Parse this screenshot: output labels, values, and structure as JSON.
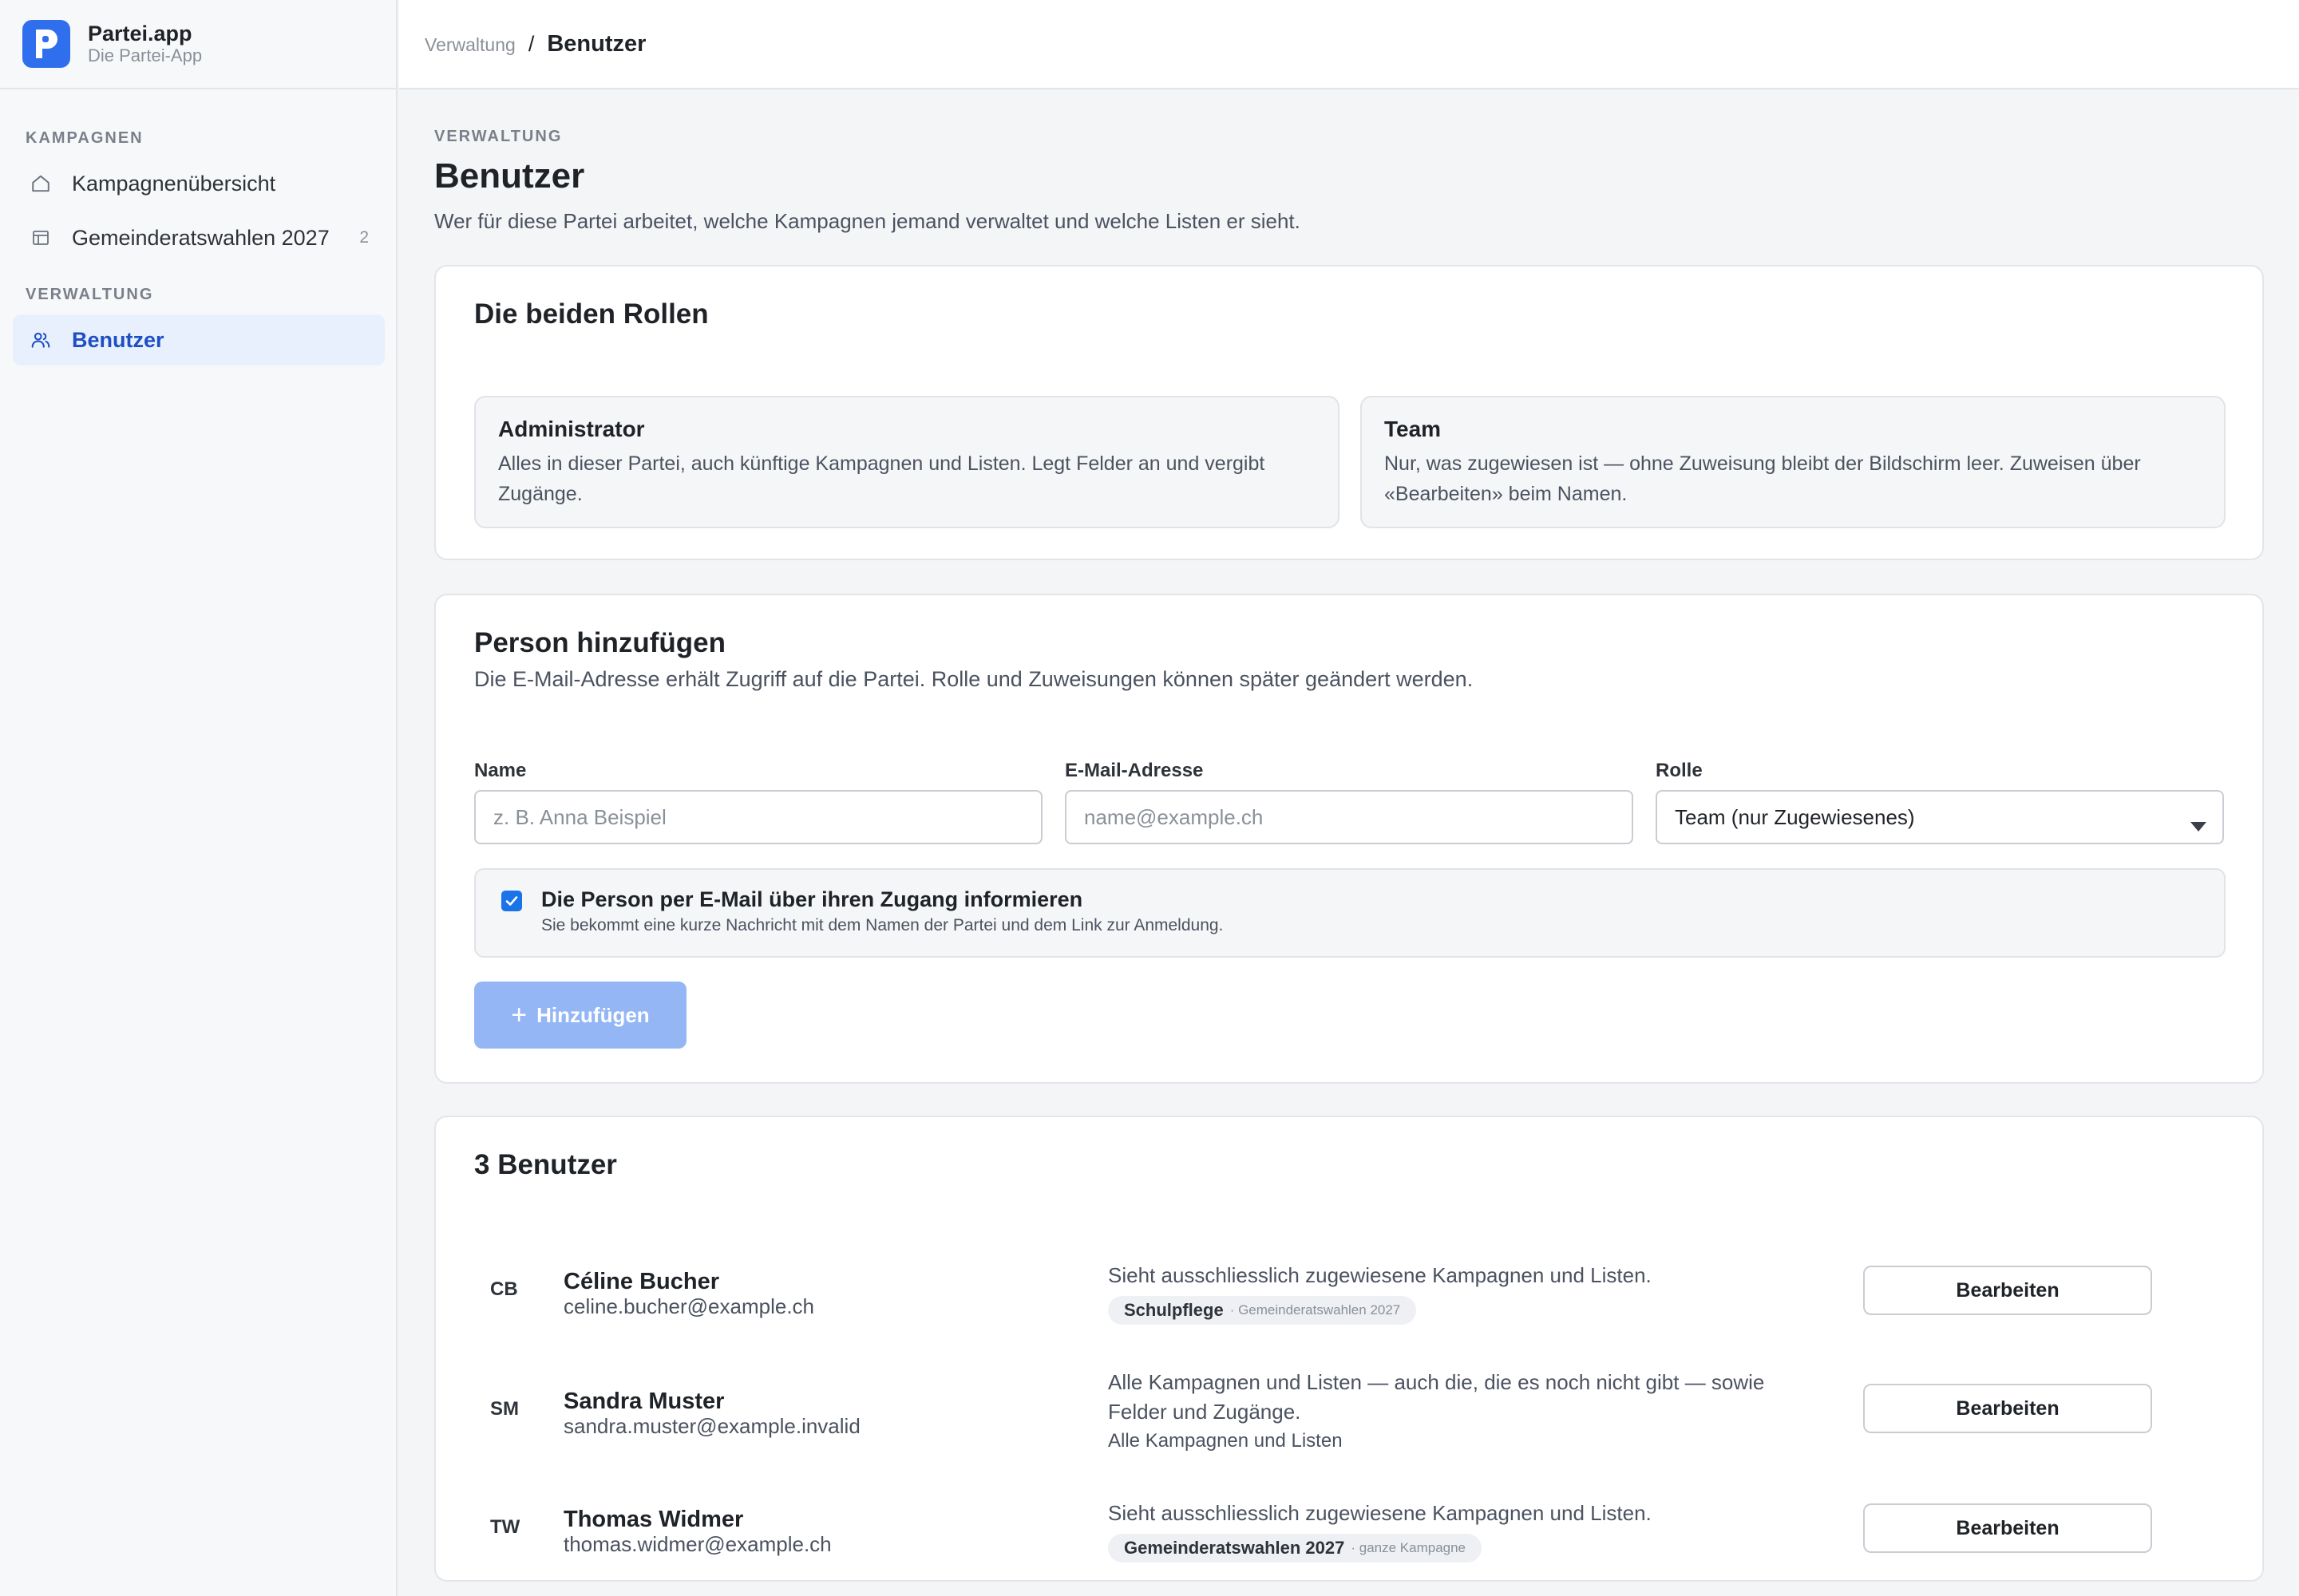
{
  "brand": {
    "name": "Partei.app",
    "subtitle": "Die Partei-App",
    "logo_icon": "p-logo-icon",
    "accent": "#2f6fed"
  },
  "sidebar": {
    "sections": [
      {
        "title": "KAMPAGNEN",
        "items": [
          {
            "label": "Kampagnenübersicht",
            "icon": "home-icon",
            "count": ""
          },
          {
            "label": "Gemeinderatswahlen 2027",
            "icon": "layout-icon",
            "count": "2"
          }
        ]
      },
      {
        "title": "VERWALTUNG",
        "items": [
          {
            "label": "Benutzer",
            "icon": "users-icon",
            "active": true
          }
        ]
      }
    ]
  },
  "breadcrumb": {
    "parent": "Verwaltung",
    "separator": "/",
    "current": "Benutzer"
  },
  "page": {
    "eyebrow": "VERWALTUNG",
    "title": "Benutzer",
    "description": "Wer für diese Partei arbeitet, welche Kampagnen jemand verwaltet und welche Listen er sieht."
  },
  "roles": {
    "title": "Die beiden Rollen",
    "items": [
      {
        "name": "Administrator",
        "description": "Alles in dieser Partei, auch künftige Kampagnen und Listen. Legt Felder an und vergibt Zugänge."
      },
      {
        "name": "Team",
        "description": "Nur, was zugewiesen ist — ohne Zuweisung bleibt der Bildschirm leer. Zuweisen über «Bearbeiten» beim Namen."
      }
    ]
  },
  "add_person": {
    "title": "Person hinzufügen",
    "description": "Die E-Mail-Adresse erhält Zugriff auf die Partei. Rolle und Zuweisungen können später geändert werden.",
    "name_label": "Name",
    "name_placeholder": "z. B. Anna Beispiel",
    "email_label": "E-Mail-Adresse",
    "email_placeholder": "name@example.ch",
    "role_label": "Rolle",
    "role_value": "Team (nur Zugewiesenes)",
    "notify_checked": true,
    "notify_title": "Die Person per E-Mail über ihren Zugang informieren",
    "notify_subtitle": "Sie bekommt eine kurze Nachricht mit dem Namen der Partei und dem Link zur Anmeldung.",
    "add_button": "Hinzufügen",
    "add_button_color": "#94b6f5"
  },
  "users": {
    "title": "3 Benutzer",
    "edit_label": "Bearbeiten",
    "rows": [
      {
        "initials": "CB",
        "name": "Céline Bucher",
        "email": "celine.bucher@example.ch",
        "description": "Sieht ausschliesslich zugewiesene Kampagnen und Listen.",
        "chip_strong": "Schulpflege",
        "chip_light": "· Gemeinderatswahlen 2027"
      },
      {
        "initials": "SM",
        "name": "Sandra Muster",
        "email": "sandra.muster@example.invalid",
        "description": "Alle Kampagnen und Listen — auch die, die es noch nicht gibt — sowie Felder und Zugänge.",
        "scope": "Alle Kampagnen und Listen"
      },
      {
        "initials": "TW",
        "name": "Thomas Widmer",
        "email": "thomas.widmer@example.ch",
        "description": "Sieht ausschliesslich zugewiesene Kampagnen und Listen.",
        "chip_strong": "Gemeinderatswahlen 2027",
        "chip_light": "· ganze Kampagne"
      }
    ]
  }
}
